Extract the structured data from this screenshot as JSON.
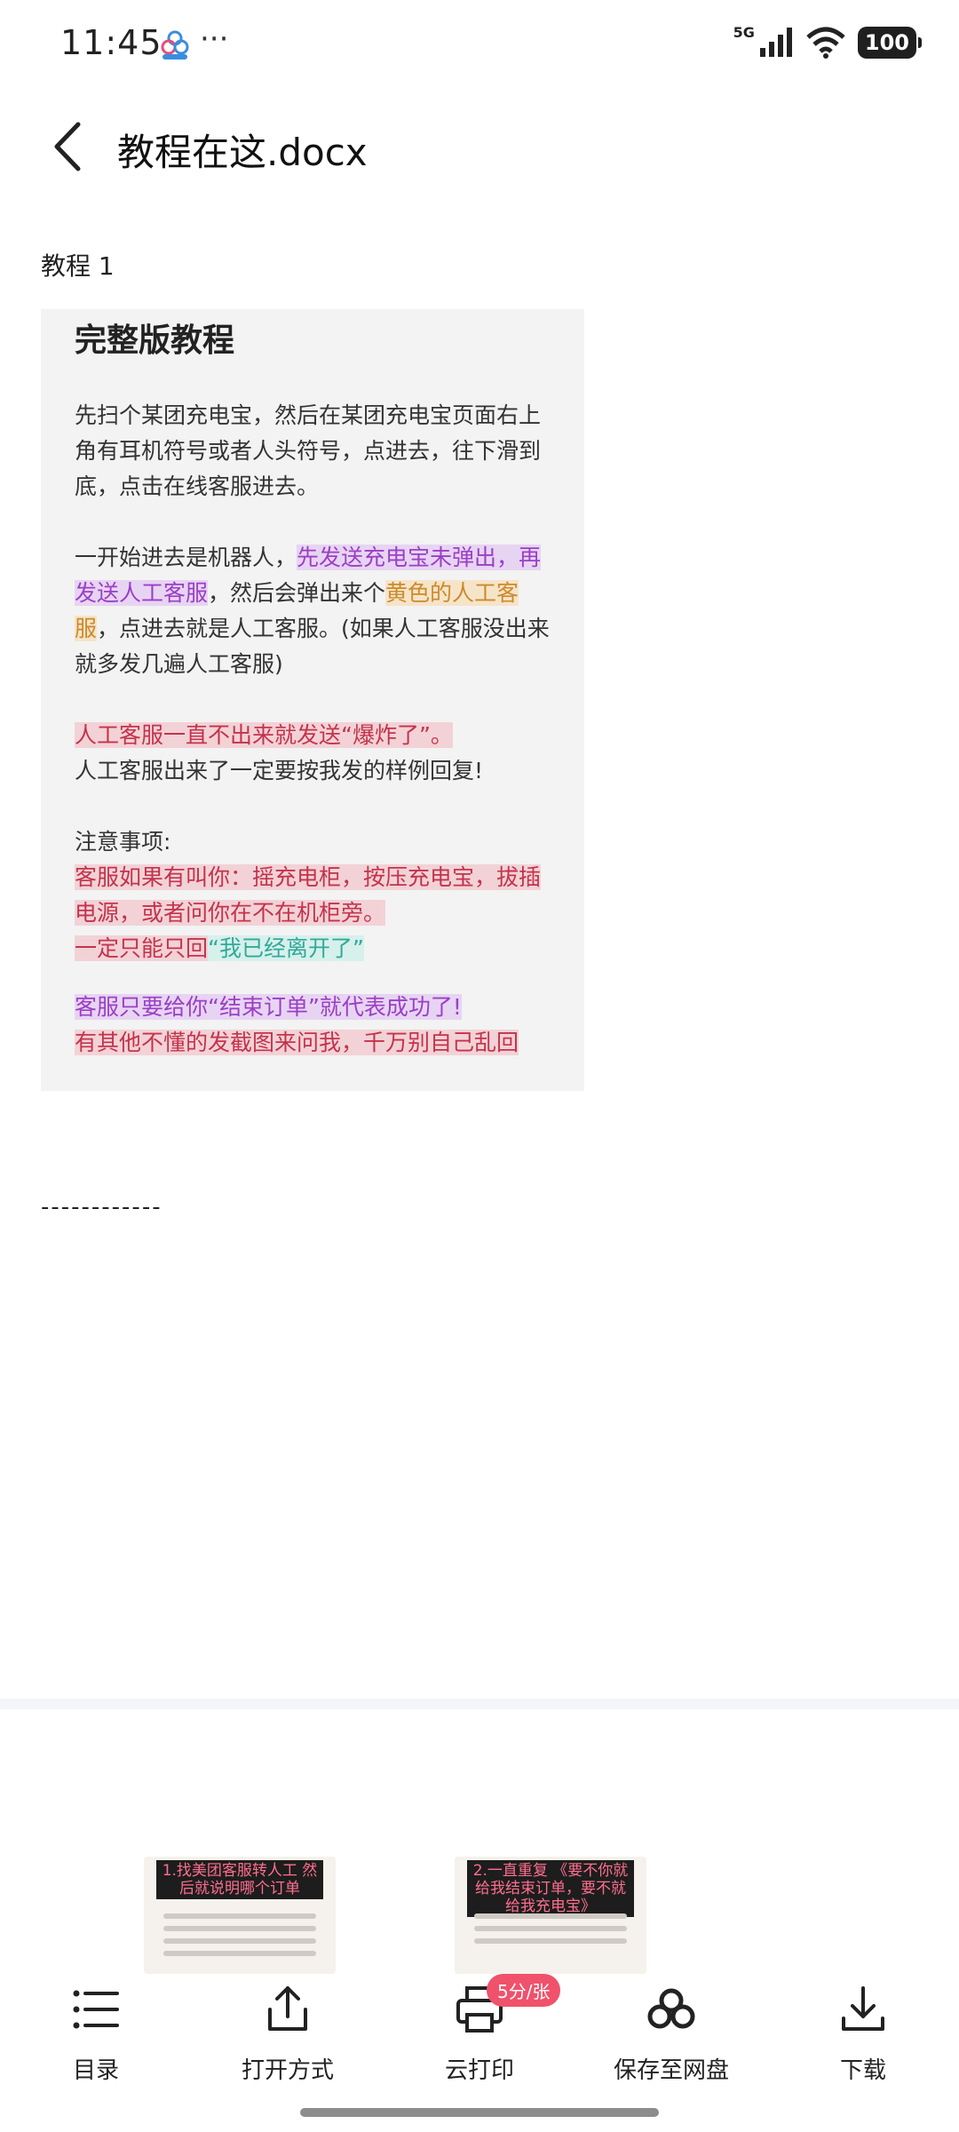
{
  "status_bar": {
    "time": "11:45",
    "more_dots": "···",
    "network": "5G",
    "battery": "100"
  },
  "header": {
    "title": "教程在这.docx"
  },
  "document": {
    "heading": "教程 1",
    "image": {
      "title": "完整版教程",
      "para1": "先扫个某团充电宝，然后在某团充电宝页面右上角有耳机符号或者人头符号，点进去，往下滑到底，点击在线客服进去。",
      "para2_a": "一开始进去是机器人，",
      "para2_b": "先发送充电宝未弹出，再发送人工客服",
      "para2_c": "，然后会弹出来个",
      "para2_d": "黄色的人工客服",
      "para2_e": "，点进去就是人工客服。(如果人工客服没出来就多发几遍人工客服)",
      "para3_a": "人工客服一直不出来就发送“爆炸了”。",
      "para3_b": "人工客服出来了一定要按我发的样例回复!",
      "para4_a": "注意事项:",
      "para4_b": "客服如果有叫你：摇充电柜，按压充电宝，拔插电源，或者问你在不在机柜旁。",
      "para4_c": "一定只能只回",
      "para4_d": "“我已经离开了”",
      "para5_a": "客服只要给你“结束订单”就代表成功了!",
      "para5_b": "有其他不懂的发截图来问我，千万别自己乱回"
    },
    "divider": "------------"
  },
  "thumbnails": [
    {
      "caption": "1.找美团客服转人工 然后就说明哪个订单"
    },
    {
      "caption": "2.一直重复 《要不你就给我结束订单，要不就给我充电宝》"
    }
  ],
  "toolbar": {
    "items": [
      {
        "label": "目录",
        "icon": "list-icon"
      },
      {
        "label": "打开方式",
        "icon": "share-icon"
      },
      {
        "label": "云打印",
        "icon": "printer-icon",
        "badge": "5分/张"
      },
      {
        "label": "保存至网盘",
        "icon": "cloud-disk-icon"
      },
      {
        "label": "下载",
        "icon": "download-icon"
      }
    ]
  },
  "colors": {
    "highlight_purple": "#9b3fc6",
    "highlight_orange": "#cc8a2a",
    "highlight_red": "#c4334c",
    "highlight_teal": "#32a99a",
    "badge": "#f0516b"
  }
}
